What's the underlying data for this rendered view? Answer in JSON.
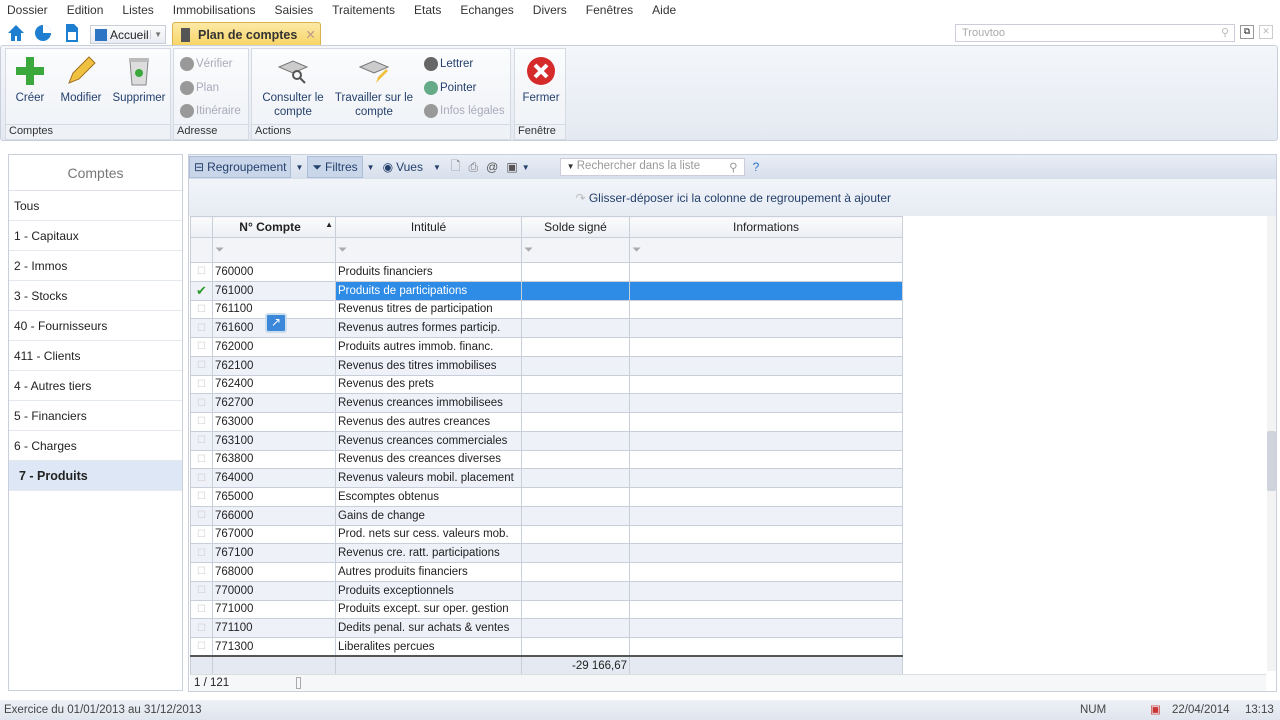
{
  "menu": [
    "Dossier",
    "Edition",
    "Listes",
    "Immobilisations",
    "Saisies",
    "Traitements",
    "Etats",
    "Echanges",
    "Divers",
    "Fenêtres",
    "Aide"
  ],
  "tabbar": {
    "home": "Accueil",
    "active_tab": "Plan de comptes",
    "search_placeholder": "Trouvtoo"
  },
  "ribbon": {
    "comptes": {
      "label": "Comptes",
      "creer": "Créer",
      "modifier": "Modifier",
      "supprimer": "Supprimer"
    },
    "adresse": {
      "label": "Adresse",
      "verifier": "Vérifier",
      "plan": "Plan",
      "itineraire": "Itinéraire"
    },
    "actions": {
      "label": "Actions",
      "consulter": "Consulter le compte",
      "travailler": "Travailler sur le compte",
      "lettrer": "Lettrer",
      "pointer": "Pointer",
      "infos": "Infos légales"
    },
    "fenetre": {
      "label": "Fenêtre",
      "fermer": "Fermer"
    }
  },
  "sidebar": {
    "title": "Comptes",
    "items": [
      "Tous",
      "1 - Capitaux",
      "2 - Immos",
      "3 - Stocks",
      "40 - Fournisseurs",
      "411 - Clients",
      "4 - Autres tiers",
      "5 - Financiers",
      "6 - Charges",
      "7 - Produits"
    ],
    "selected": "7 - Produits"
  },
  "grid": {
    "toolbar": {
      "regroupement": "Regroupement",
      "filtres": "Filtres",
      "vues": "Vues",
      "search_placeholder": "Rechercher dans la liste",
      "help": "?"
    },
    "grouping_hint": "Glisser-déposer ici la colonne de regroupement à ajouter",
    "columns": [
      "N° Compte",
      "Intitulé",
      "Solde signé",
      "Informations"
    ],
    "rows": [
      [
        "760000",
        "Produits financiers"
      ],
      [
        "761000",
        "Produits de participations"
      ],
      [
        "761100",
        "Revenus titres de participation"
      ],
      [
        "761600",
        "Revenus autres formes particip."
      ],
      [
        "762000",
        "Produits autres immob. financ."
      ],
      [
        "762100",
        "Revenus des titres immobilises"
      ],
      [
        "762400",
        "Revenus des prets"
      ],
      [
        "762700",
        "Revenus creances immobilisees"
      ],
      [
        "763000",
        "Revenus des autres creances"
      ],
      [
        "763100",
        "Revenus creances commerciales"
      ],
      [
        "763800",
        "Revenus des creances diverses"
      ],
      [
        "764000",
        "Revenus valeurs mobil. placement"
      ],
      [
        "765000",
        "Escomptes obtenus"
      ],
      [
        "766000",
        "Gains de change"
      ],
      [
        "767000",
        "Prod. nets sur cess. valeurs mob."
      ],
      [
        "767100",
        "Revenus cre. ratt. participations"
      ],
      [
        "768000",
        "Autres produits financiers"
      ],
      [
        "770000",
        "Produits exceptionnels"
      ],
      [
        "771000",
        "Produits except. sur oper. gestion"
      ],
      [
        "771100",
        "Dedits penal. sur achats & ventes"
      ],
      [
        "771300",
        "Liberalites percues"
      ]
    ],
    "selected_row": 1,
    "total": "-29 166,67",
    "pager": "1 / 121"
  },
  "status": {
    "exercice": "Exercice du 01/01/2013 au 31/12/2013",
    "num": "NUM",
    "date": "22/04/2014",
    "time": "13:13"
  }
}
